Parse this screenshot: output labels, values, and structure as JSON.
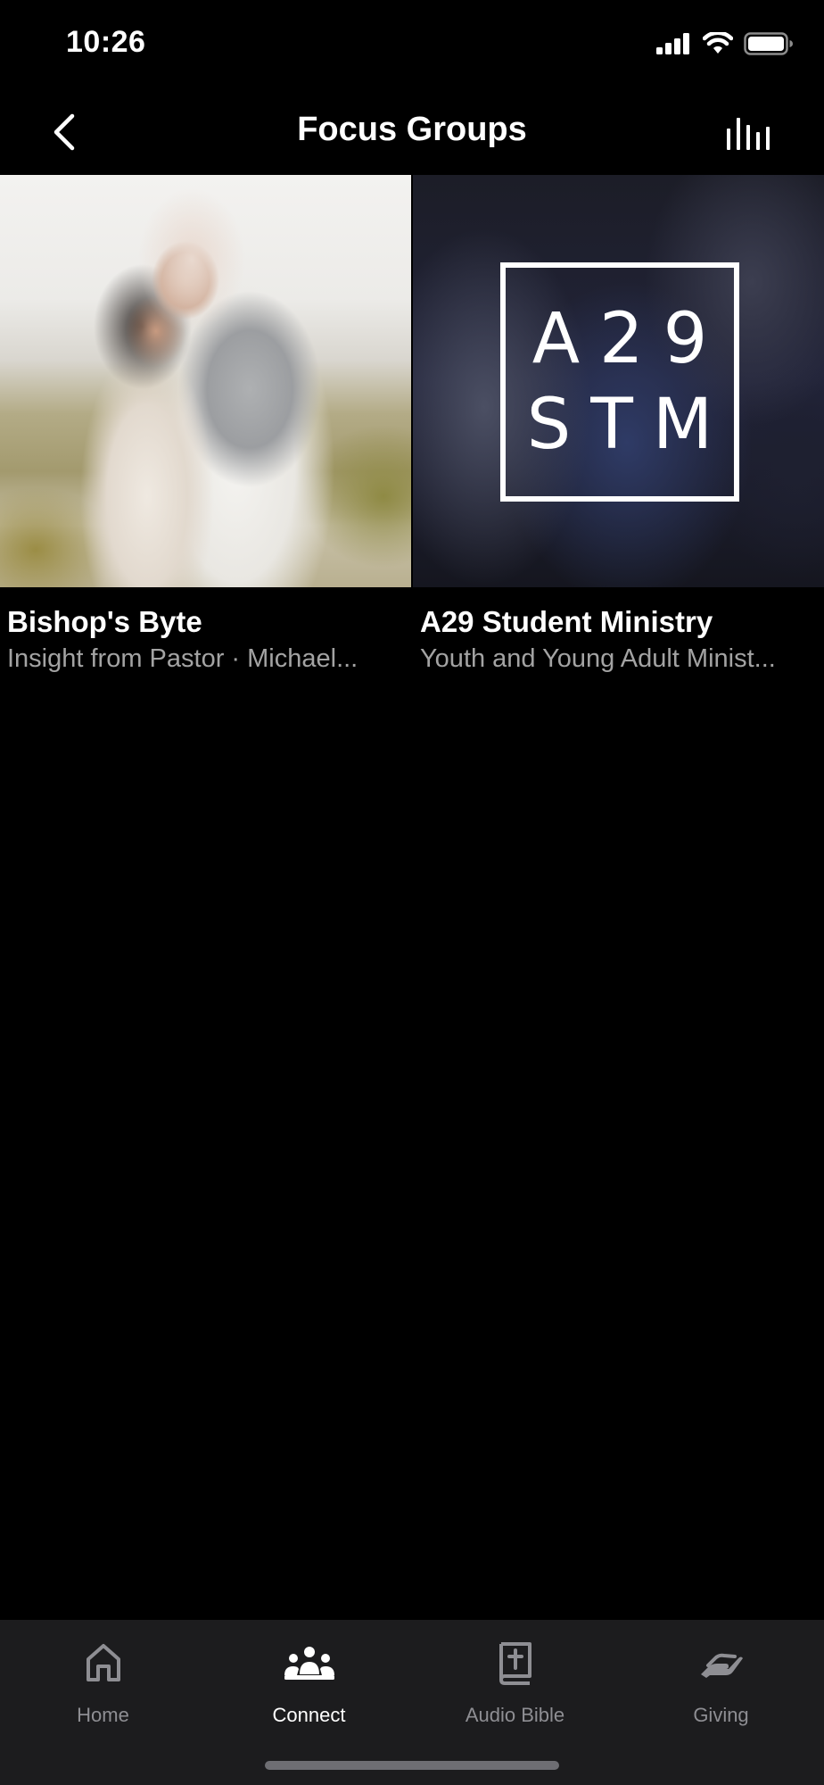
{
  "status_bar": {
    "time": "10:26",
    "icons": [
      "signal-icon",
      "wifi-icon",
      "battery-icon"
    ]
  },
  "nav": {
    "title": "Focus Groups",
    "back_icon": "chevron-left-icon",
    "right_icon": "stats-bars-icon"
  },
  "groups": [
    {
      "title": "Bishop's Byte",
      "subtitle": "Insight from Pastor · Michael..."
    },
    {
      "title": "A29 Student Ministry",
      "subtitle": "Youth and Young Adult Minist...",
      "logo_lines": [
        "A29",
        "STM"
      ]
    }
  ],
  "tabs": [
    {
      "label": "Home",
      "icon": "home-icon",
      "active": false
    },
    {
      "label": "Connect",
      "icon": "people-icon",
      "active": true
    },
    {
      "label": "Audio Bible",
      "icon": "bible-icon",
      "active": false
    },
    {
      "label": "Giving",
      "icon": "giving-hand-icon",
      "active": false
    }
  ],
  "colors": {
    "background": "#000000",
    "tab_bar": "#1c1c1e",
    "inactive": "#8e8e93",
    "subtitle": "#a3a3a3",
    "active": "#ffffff"
  }
}
